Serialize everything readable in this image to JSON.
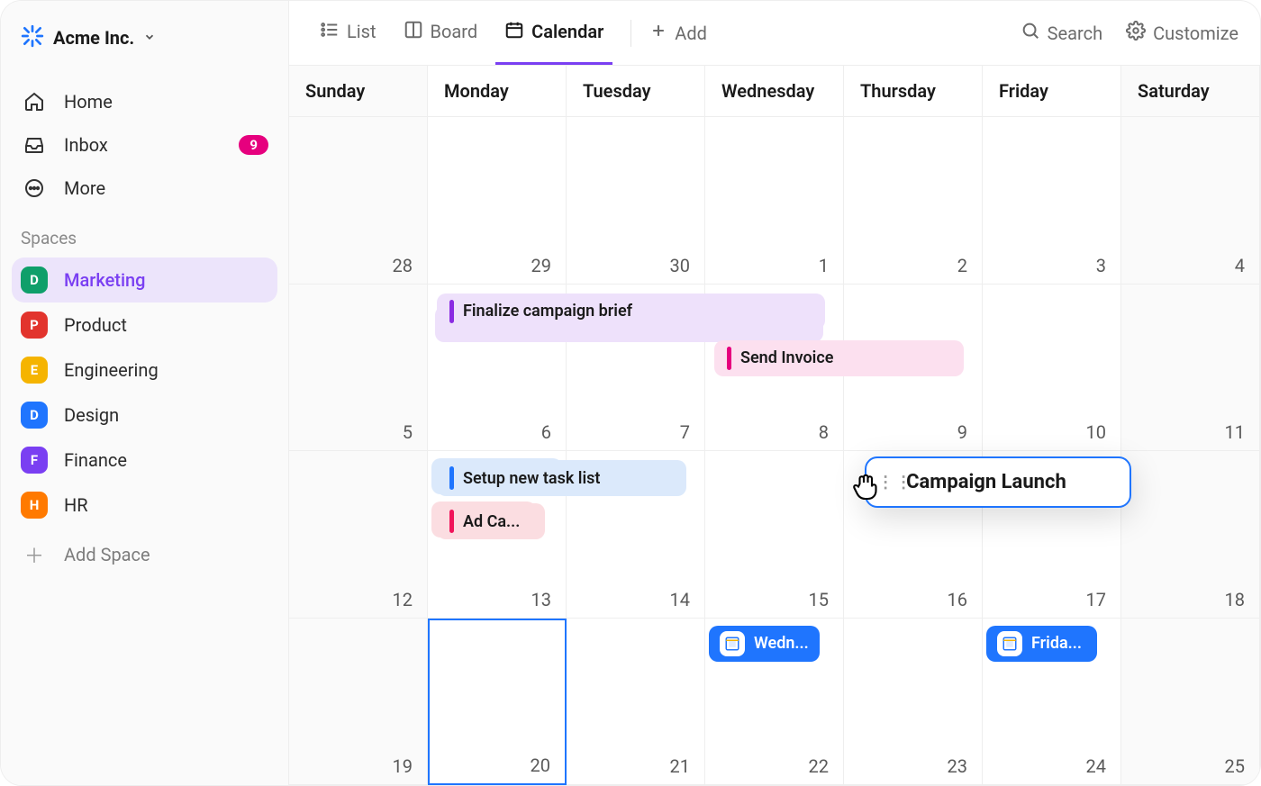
{
  "workspace": {
    "name": "Acme Inc."
  },
  "nav": {
    "home": "Home",
    "inbox": "Inbox",
    "inbox_badge": "9",
    "more": "More"
  },
  "spaces_label": "Spaces",
  "spaces": [
    {
      "letter": "D",
      "name": "Marketing",
      "color": "#0f9f6a",
      "active": true
    },
    {
      "letter": "P",
      "name": "Product",
      "color": "#e2342d",
      "active": false
    },
    {
      "letter": "E",
      "name": "Engineering",
      "color": "#f5b400",
      "active": false
    },
    {
      "letter": "D",
      "name": "Design",
      "color": "#1f75fe",
      "active": false
    },
    {
      "letter": "F",
      "name": "Finance",
      "color": "#7a3ff2",
      "active": false
    },
    {
      "letter": "H",
      "name": "HR",
      "color": "#ff7a00",
      "active": false
    }
  ],
  "add_space": "Add Space",
  "tabs": {
    "list": "List",
    "board": "Board",
    "calendar": "Calendar",
    "add": "Add"
  },
  "topright": {
    "search": "Search",
    "customize": "Customize"
  },
  "days": [
    "Sunday",
    "Monday",
    "Tuesday",
    "Wednesday",
    "Thursday",
    "Friday",
    "Saturday"
  ],
  "grid_days": [
    "28",
    "29",
    "30",
    "1",
    "2",
    "3",
    "4",
    "5",
    "6",
    "7",
    "8",
    "9",
    "10",
    "11",
    "12",
    "13",
    "14",
    "15",
    "16",
    "17",
    "18",
    "19",
    "20",
    "21",
    "22",
    "23",
    "24",
    "25"
  ],
  "events": {
    "finalize": "Finalize campaign brief",
    "invoice": "Send Invoice",
    "setup": "Setup new task list",
    "adc": "Ad Ca...",
    "wed": "Wedn...",
    "fri": "Frida..."
  },
  "drag_card": "Campaign Launch"
}
